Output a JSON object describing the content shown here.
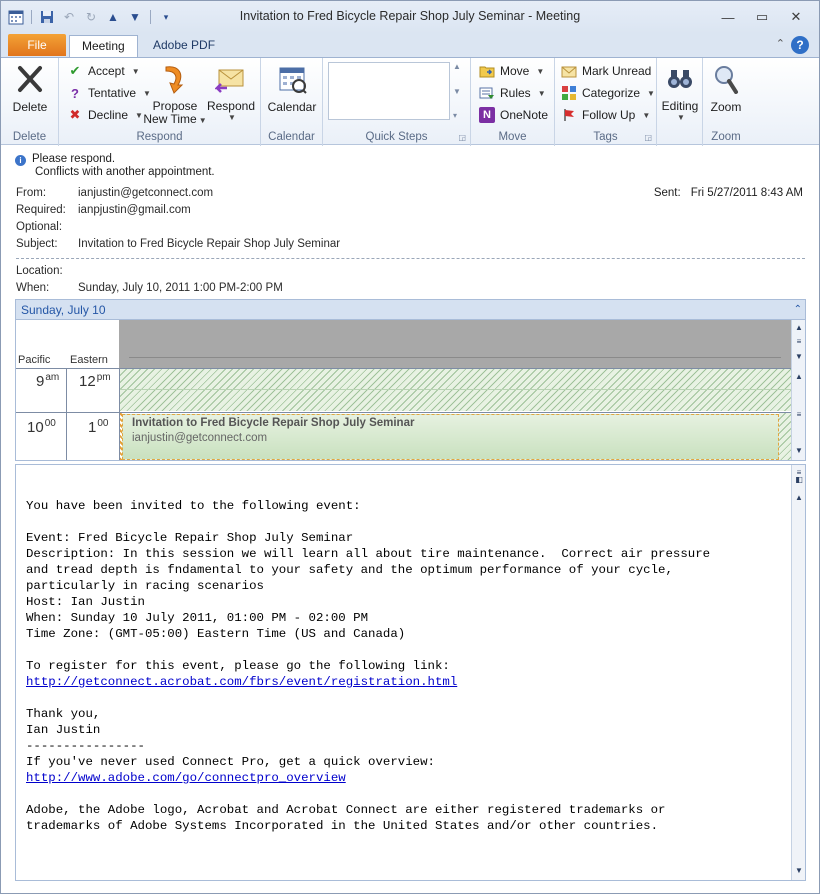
{
  "window": {
    "title": "Invitation to Fred Bicycle Repair Shop July Seminar  -  Meeting",
    "quick_access": [
      "calendar-icon",
      "save-icon",
      "undo-icon",
      "redo-icon",
      "previous-icon",
      "next-icon",
      "customize-icon"
    ]
  },
  "tabs": {
    "file": "File",
    "meeting": "Meeting",
    "adobe_pdf": "Adobe PDF"
  },
  "ribbon": {
    "delete_group": {
      "delete": "Delete",
      "label": "Delete"
    },
    "respond_group": {
      "accept": "Accept",
      "tentative": "Tentative",
      "decline": "Decline",
      "propose_line1": "Propose",
      "propose_line2": "New Time",
      "respond": "Respond",
      "label": "Respond"
    },
    "calendar_group": {
      "calendar": "Calendar",
      "label": "Calendar"
    },
    "quicksteps_group": {
      "label": "Quick Steps"
    },
    "move_group": {
      "move": "Move",
      "rules": "Rules",
      "onenote": "OneNote",
      "label": "Move"
    },
    "tags_group": {
      "mark_unread": "Mark Unread",
      "categorize": "Categorize",
      "follow_up": "Follow Up",
      "label": "Tags"
    },
    "editing_group": {
      "editing": "Editing"
    },
    "zoom_group": {
      "zoom": "Zoom",
      "label": "Zoom"
    }
  },
  "info": {
    "line1": "Please respond.",
    "line2": "Conflicts with another appointment."
  },
  "header": {
    "from_label": "From:",
    "from": "ianjustin@getconnect.com",
    "required_label": "Required:",
    "required": "ianpjustin@gmail.com",
    "optional_label": "Optional:",
    "optional": "",
    "subject_label": "Subject:",
    "subject": "Invitation to Fred Bicycle Repair Shop July Seminar",
    "sent_label": "Sent:",
    "sent": "Fri 5/27/2011 8:43 AM",
    "location_label": "Location:",
    "location": "",
    "when_label": "When:",
    "when": "Sunday, July 10, 2011 1:00 PM-2:00 PM"
  },
  "calendar": {
    "day": "Sunday, July 10",
    "tz1": "Pacific",
    "tz2": "Eastern",
    "row1_pacific_hour": "9",
    "row1_pacific_suffix": "am",
    "row1_eastern_hour": "12",
    "row1_eastern_suffix": "pm",
    "row2_pacific_hour": "10",
    "row2_pacific_suffix": "00",
    "row2_eastern_hour": "1",
    "row2_eastern_suffix": "00",
    "appointment_title": "Invitation to Fred Bicycle Repair Shop July Seminar",
    "appointment_organizer": "ianjustin@getconnect.com"
  },
  "body": {
    "intro": "You have been invited to the following event:",
    "event": "Event: Fred Bicycle Repair Shop July Seminar",
    "description_1": "Description: In this session we will learn all about tire maintenance.  Correct air pressure",
    "description_2": "and tread depth is fndamental to your safety and the optimum performance of your cycle,",
    "description_3": "particularly in racing scenarios",
    "host": "Host: Ian Justin",
    "when": "When: Sunday 10 July 2011, 01:00 PM - 02:00 PM",
    "timezone": "Time Zone: (GMT-05:00) Eastern Time (US and Canada)",
    "register_text": "To register for this event, please go the following link:",
    "register_link": "http://getconnect.acrobat.com/fbrs/event/registration.html",
    "thanks": "Thank you,",
    "signature": "Ian Justin",
    "divider": "----------------",
    "overview_text": "If you've never used Connect Pro, get a quick overview:",
    "overview_link": "http://www.adobe.com/go/connectpro_overview",
    "legal_1": "Adobe, the Adobe logo, Acrobat and Acrobat Connect are either registered trademarks or",
    "legal_2": "trademarks of Adobe Systems Incorporated in the United States and/or other countries."
  }
}
